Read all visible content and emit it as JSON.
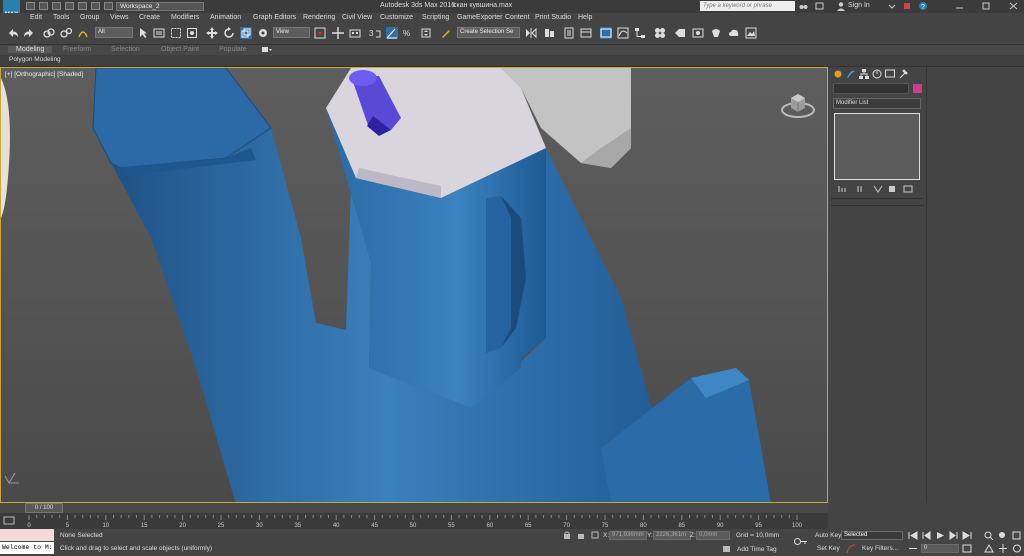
{
  "titlebar": {
    "logo_text": "MAX",
    "workspace": "Workspace_2",
    "app_title": "Autodesk 3ds Max 2016",
    "file_name": "скан кувшина.max",
    "search_placeholder": "Type a keyword or phrase",
    "sign_in": "Sign In"
  },
  "menu": [
    "Edit",
    "Tools",
    "Group",
    "Views",
    "Create",
    "Modifiers",
    "Animation",
    "Graph Editors",
    "Rendering",
    "Civil View",
    "Customize",
    "Scripting",
    "GameExporter",
    "Content",
    "Print Studio",
    "Help"
  ],
  "toolbar": {
    "filter_value": "All",
    "view_value": "View",
    "selection_set_placeholder": "Create Selection Se"
  },
  "ribbon": {
    "tabs": [
      "Modeling",
      "Freeform",
      "Selection",
      "Object Paint",
      "Populate"
    ],
    "active_tab": "Modeling",
    "sub_label": "Polygon Modeling"
  },
  "viewport": {
    "label": "[+] [Orthographic] [Shaded]",
    "model_color": "#2f72ae",
    "background": "#5a5a5a"
  },
  "command_panel": {
    "modifier_list": "Modifier List"
  },
  "timeline": {
    "slider_text": "0 / 100",
    "ticks": [
      "0",
      "5",
      "10",
      "15",
      "20",
      "25",
      "30",
      "35",
      "40",
      "45",
      "50",
      "55",
      "60",
      "65",
      "70",
      "75",
      "80",
      "85",
      "90",
      "95",
      "100"
    ]
  },
  "status": {
    "script_box": "Welcome to M:",
    "selection": "None Selected",
    "prompt": "Click and drag to select and scale objects (uniformly)",
    "x_label": "X:",
    "x_value": "971,936mm",
    "y_label": "Y:",
    "y_value": "2226,361m",
    "z_label": "Z:",
    "z_value": "0,0mm",
    "grid": "Grid = 10,0mm",
    "add_time_tag": "Add Time Tag",
    "auto_key": "Auto Key",
    "set_key": "Set Key",
    "selected_value": "Selected",
    "key_filters": "Key Filters...",
    "frame_value": "0"
  }
}
